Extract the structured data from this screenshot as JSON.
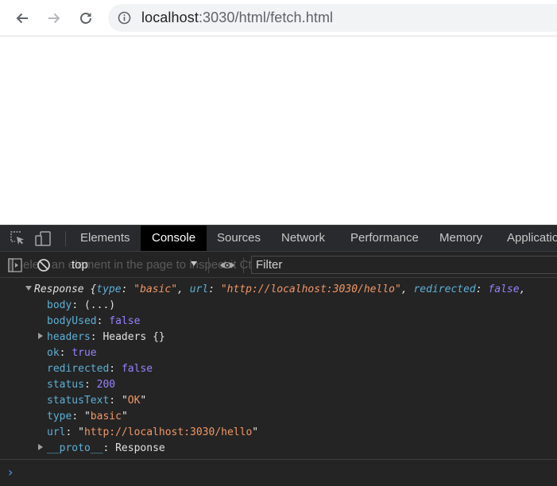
{
  "browser": {
    "url_host": "localhost",
    "url_rest": ":3030/html/fetch.html",
    "icons": [
      "back-arrow-icon",
      "forward-arrow-icon",
      "reload-icon",
      "info-icon"
    ]
  },
  "devtools": {
    "tabs": [
      {
        "label": "Elements",
        "active": false
      },
      {
        "label": "Console",
        "active": true
      },
      {
        "label": "Sources",
        "active": false
      },
      {
        "label": "Network",
        "active": false
      },
      {
        "label": "Performance",
        "active": false
      },
      {
        "label": "Memory",
        "active": false
      },
      {
        "label": "Applicatio",
        "active": false
      }
    ],
    "toolbar": {
      "ghost_text": "Select an element in the page to inspect it  Ctrl + Shift + C",
      "context": "top",
      "filter_placeholder": "Filter"
    },
    "console": {
      "response_label": "Response",
      "summary": {
        "type_key": "type",
        "type_value": "\"basic\"",
        "url_key": "url",
        "url_value": "\"http://localhost:3030/hello\"",
        "redirected_key": "redirected",
        "redirected_value": "false"
      },
      "props": {
        "body_key": "body",
        "body_value": "(...)",
        "bodyUsed_key": "bodyUsed",
        "bodyUsed_value": "false",
        "headers_key": "headers",
        "headers_value": "Headers {}",
        "ok_key": "ok",
        "ok_value": "true",
        "redirected_key": "redirected",
        "redirected_value": "false",
        "status_key": "status",
        "status_value": "200",
        "statusText_key": "statusText",
        "statusText_value": "OK",
        "type_key": "type",
        "type_value": "basic",
        "url_key": "url",
        "url_value": "http://localhost:3030/hello",
        "proto_key": "__proto__",
        "proto_value": "Response"
      }
    },
    "colors": {
      "key": "#5db0d7",
      "number_boolean": "#9980ff",
      "string": "#f29766",
      "prompt": "#4a9cf0"
    }
  }
}
